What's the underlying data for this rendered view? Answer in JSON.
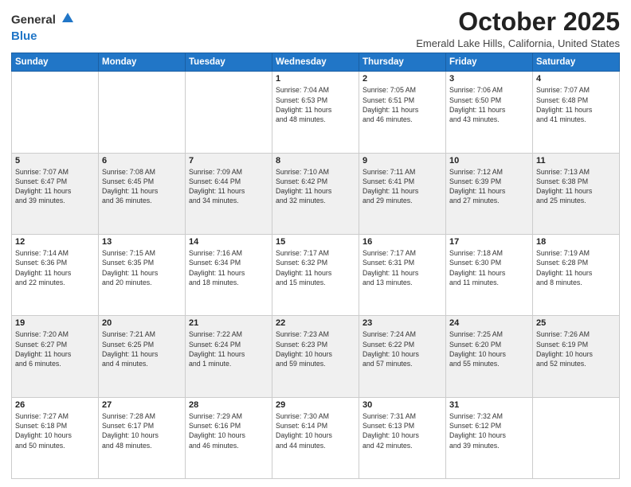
{
  "header": {
    "logo_general": "General",
    "logo_blue": "Blue",
    "month_title": "October 2025",
    "subtitle": "Emerald Lake Hills, California, United States"
  },
  "days_of_week": [
    "Sunday",
    "Monday",
    "Tuesday",
    "Wednesday",
    "Thursday",
    "Friday",
    "Saturday"
  ],
  "weeks": [
    [
      {
        "day": "",
        "info": ""
      },
      {
        "day": "",
        "info": ""
      },
      {
        "day": "",
        "info": ""
      },
      {
        "day": "1",
        "info": "Sunrise: 7:04 AM\nSunset: 6:53 PM\nDaylight: 11 hours\nand 48 minutes."
      },
      {
        "day": "2",
        "info": "Sunrise: 7:05 AM\nSunset: 6:51 PM\nDaylight: 11 hours\nand 46 minutes."
      },
      {
        "day": "3",
        "info": "Sunrise: 7:06 AM\nSunset: 6:50 PM\nDaylight: 11 hours\nand 43 minutes."
      },
      {
        "day": "4",
        "info": "Sunrise: 7:07 AM\nSunset: 6:48 PM\nDaylight: 11 hours\nand 41 minutes."
      }
    ],
    [
      {
        "day": "5",
        "info": "Sunrise: 7:07 AM\nSunset: 6:47 PM\nDaylight: 11 hours\nand 39 minutes."
      },
      {
        "day": "6",
        "info": "Sunrise: 7:08 AM\nSunset: 6:45 PM\nDaylight: 11 hours\nand 36 minutes."
      },
      {
        "day": "7",
        "info": "Sunrise: 7:09 AM\nSunset: 6:44 PM\nDaylight: 11 hours\nand 34 minutes."
      },
      {
        "day": "8",
        "info": "Sunrise: 7:10 AM\nSunset: 6:42 PM\nDaylight: 11 hours\nand 32 minutes."
      },
      {
        "day": "9",
        "info": "Sunrise: 7:11 AM\nSunset: 6:41 PM\nDaylight: 11 hours\nand 29 minutes."
      },
      {
        "day": "10",
        "info": "Sunrise: 7:12 AM\nSunset: 6:39 PM\nDaylight: 11 hours\nand 27 minutes."
      },
      {
        "day": "11",
        "info": "Sunrise: 7:13 AM\nSunset: 6:38 PM\nDaylight: 11 hours\nand 25 minutes."
      }
    ],
    [
      {
        "day": "12",
        "info": "Sunrise: 7:14 AM\nSunset: 6:36 PM\nDaylight: 11 hours\nand 22 minutes."
      },
      {
        "day": "13",
        "info": "Sunrise: 7:15 AM\nSunset: 6:35 PM\nDaylight: 11 hours\nand 20 minutes."
      },
      {
        "day": "14",
        "info": "Sunrise: 7:16 AM\nSunset: 6:34 PM\nDaylight: 11 hours\nand 18 minutes."
      },
      {
        "day": "15",
        "info": "Sunrise: 7:17 AM\nSunset: 6:32 PM\nDaylight: 11 hours\nand 15 minutes."
      },
      {
        "day": "16",
        "info": "Sunrise: 7:17 AM\nSunset: 6:31 PM\nDaylight: 11 hours\nand 13 minutes."
      },
      {
        "day": "17",
        "info": "Sunrise: 7:18 AM\nSunset: 6:30 PM\nDaylight: 11 hours\nand 11 minutes."
      },
      {
        "day": "18",
        "info": "Sunrise: 7:19 AM\nSunset: 6:28 PM\nDaylight: 11 hours\nand 8 minutes."
      }
    ],
    [
      {
        "day": "19",
        "info": "Sunrise: 7:20 AM\nSunset: 6:27 PM\nDaylight: 11 hours\nand 6 minutes."
      },
      {
        "day": "20",
        "info": "Sunrise: 7:21 AM\nSunset: 6:25 PM\nDaylight: 11 hours\nand 4 minutes."
      },
      {
        "day": "21",
        "info": "Sunrise: 7:22 AM\nSunset: 6:24 PM\nDaylight: 11 hours\nand 1 minute."
      },
      {
        "day": "22",
        "info": "Sunrise: 7:23 AM\nSunset: 6:23 PM\nDaylight: 10 hours\nand 59 minutes."
      },
      {
        "day": "23",
        "info": "Sunrise: 7:24 AM\nSunset: 6:22 PM\nDaylight: 10 hours\nand 57 minutes."
      },
      {
        "day": "24",
        "info": "Sunrise: 7:25 AM\nSunset: 6:20 PM\nDaylight: 10 hours\nand 55 minutes."
      },
      {
        "day": "25",
        "info": "Sunrise: 7:26 AM\nSunset: 6:19 PM\nDaylight: 10 hours\nand 52 minutes."
      }
    ],
    [
      {
        "day": "26",
        "info": "Sunrise: 7:27 AM\nSunset: 6:18 PM\nDaylight: 10 hours\nand 50 minutes."
      },
      {
        "day": "27",
        "info": "Sunrise: 7:28 AM\nSunset: 6:17 PM\nDaylight: 10 hours\nand 48 minutes."
      },
      {
        "day": "28",
        "info": "Sunrise: 7:29 AM\nSunset: 6:16 PM\nDaylight: 10 hours\nand 46 minutes."
      },
      {
        "day": "29",
        "info": "Sunrise: 7:30 AM\nSunset: 6:14 PM\nDaylight: 10 hours\nand 44 minutes."
      },
      {
        "day": "30",
        "info": "Sunrise: 7:31 AM\nSunset: 6:13 PM\nDaylight: 10 hours\nand 42 minutes."
      },
      {
        "day": "31",
        "info": "Sunrise: 7:32 AM\nSunset: 6:12 PM\nDaylight: 10 hours\nand 39 minutes."
      },
      {
        "day": "",
        "info": ""
      }
    ]
  ]
}
